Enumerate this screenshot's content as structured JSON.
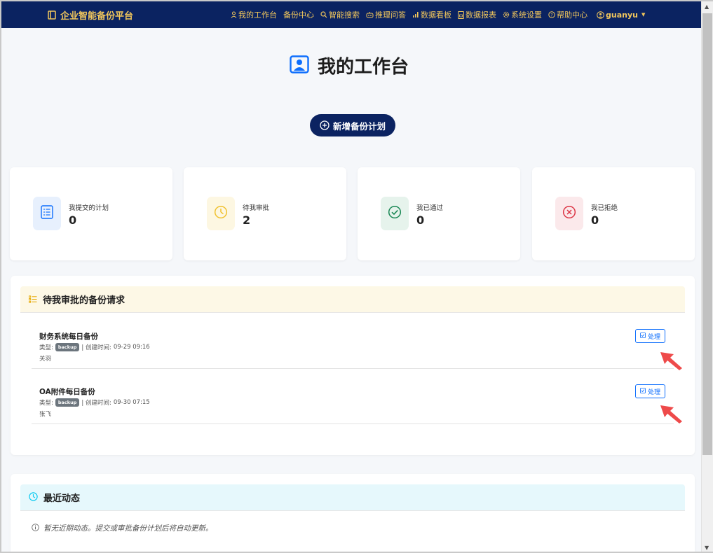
{
  "colors": {
    "navbar_bg": "#0b2361",
    "navbar_text": "#f2c75c",
    "primary": "#0d6efd",
    "pending_header_bg": "#fdf8e6",
    "activity_header_bg": "#e6f8fc"
  },
  "brand": {
    "title": "企业智能备份平台",
    "icon": "book-icon"
  },
  "nav": {
    "items": [
      {
        "label": "我的工作台",
        "icon": "person-icon"
      },
      {
        "label": "备份中心",
        "icon": ""
      },
      {
        "label": "智能搜索",
        "icon": "search-icon"
      },
      {
        "label": "推理问答",
        "icon": "robot-icon"
      },
      {
        "label": "数据看板",
        "icon": "bar-chart-icon"
      },
      {
        "label": "数据报表",
        "icon": "report-icon"
      },
      {
        "label": "系统设置",
        "icon": "gear-icon"
      },
      {
        "label": "帮助中心",
        "icon": "question-icon"
      }
    ],
    "user": {
      "name": "guanyu",
      "icon": "user-circle-icon"
    }
  },
  "page": {
    "title": "我的工作台",
    "title_icon": "person-badge-icon",
    "add_plan_label": "新增备份计划"
  },
  "stats": [
    {
      "label": "我提交的计划",
      "value": "0",
      "icon": "list-icon",
      "color": "#0d6efd",
      "bg": "#e7f0fd"
    },
    {
      "label": "待我审批",
      "value": "2",
      "icon": "clock-icon",
      "color": "#f0c12e",
      "bg": "#fdf7e2"
    },
    {
      "label": "我已通过",
      "value": "0",
      "icon": "check-circle-icon",
      "color": "#198754",
      "bg": "#e6f3ec"
    },
    {
      "label": "我已拒绝",
      "value": "0",
      "icon": "x-circle-icon",
      "color": "#dc3545",
      "bg": "#fbe9eb"
    }
  ],
  "pending": {
    "title": "待我审批的备份请求",
    "items": [
      {
        "title": "财务系统每日备份",
        "type_label": "类型:",
        "type": "backup",
        "created_label": "| 创建时间:",
        "created": "09-29 09:16",
        "user": "关羽",
        "action": "处理"
      },
      {
        "title": "OA附件每日备份",
        "type_label": "类型:",
        "type": "backup",
        "created_label": "| 创建时间:",
        "created": "09-30 07:15",
        "user": "张飞",
        "action": "处理"
      }
    ]
  },
  "activity": {
    "title": "最近动态",
    "empty_text": "暂无近期动态。提交或审批备份计划后将自动更新。"
  }
}
